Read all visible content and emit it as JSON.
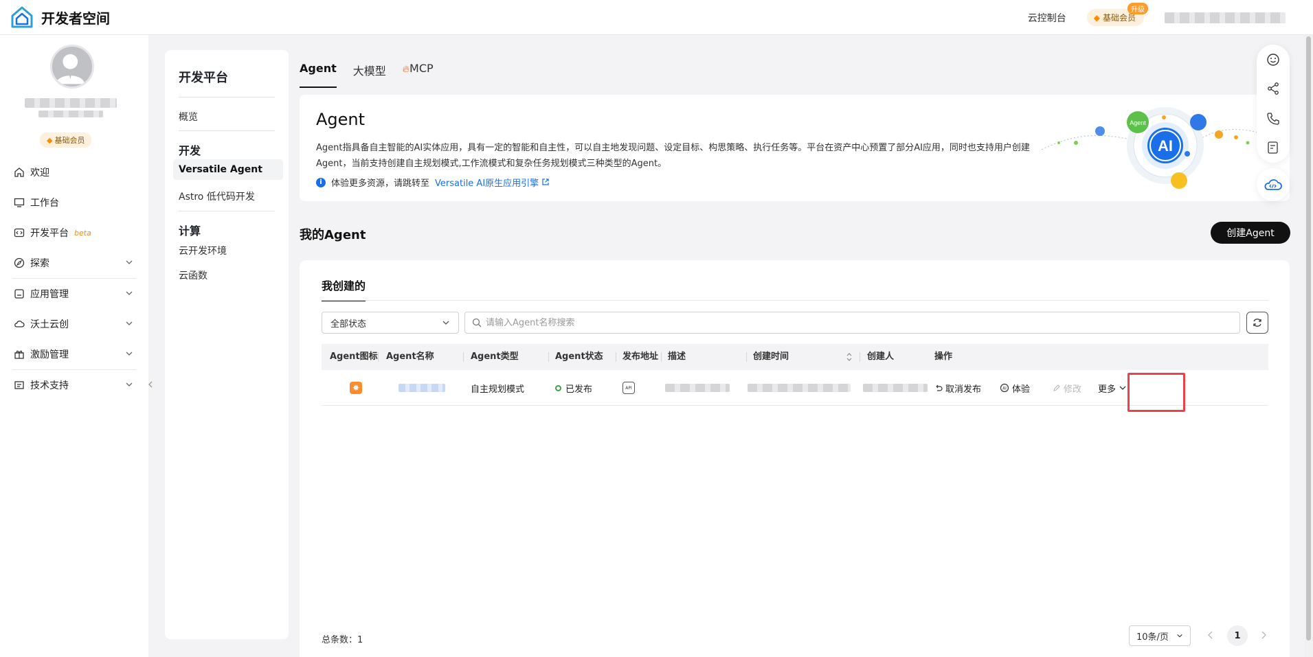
{
  "app": {
    "title": "开发者空间"
  },
  "topbar": {
    "console_label": "云控制台",
    "member_label": "基础会员",
    "upgrade_label": "升级"
  },
  "profile": {
    "badge": "基础会员"
  },
  "sidebar": {
    "items": [
      {
        "label": "欢迎",
        "icon": "home-icon"
      },
      {
        "label": "工作台",
        "icon": "monitor-icon"
      },
      {
        "label": "开发平台",
        "icon": "code-icon",
        "tag": "beta"
      },
      {
        "label": "探索",
        "icon": "compass-icon"
      },
      {
        "label": "应用管理",
        "icon": "app-icon"
      },
      {
        "label": "沃土云创",
        "icon": "cloud-icon"
      },
      {
        "label": "激励管理",
        "icon": "gift-icon"
      },
      {
        "label": "技术支持",
        "icon": "support-icon"
      }
    ]
  },
  "subnav": {
    "title": "开发平台",
    "overview": "概览",
    "group_dev": "开发",
    "versatile": "Versatile Agent",
    "astro": "Astro 低代码开发",
    "group_compute": "计算",
    "cloud_env": "云开发环境",
    "cloud_func": "云函数"
  },
  "tabs": [
    {
      "label": "Agent"
    },
    {
      "label": "大模型"
    },
    {
      "label": "MCP"
    }
  ],
  "intro": {
    "title": "Agent",
    "desc": "Agent指具备自主智能的AI实体应用，具有一定的智能和自主性，可以自主地发现问题、设定目标、构思策略、执行任务等。平台在资产中心预置了部分AI应用，同时也支持用户创建Agent，当前支持创建自主规划模式,工作流模式和复杂任务规划模式三种类型的Agent。",
    "link_prefix": "体验更多资源，请跳转至",
    "link_text": "Versatile AI原生应用引擎",
    "illus_agent": "Agent",
    "illus_ai": "AI"
  },
  "my_agent": {
    "title": "我的Agent",
    "create_button": "创建Agent",
    "tab": "我创建的",
    "status_filter": "全部状态",
    "search_placeholder": "请输入Agent名称搜索",
    "columns": [
      "Agent图标",
      "Agent名称",
      "Agent类型",
      "Agent状态",
      "发布地址",
      "描述",
      "创建时间",
      "创建人",
      "操作"
    ],
    "rows": [
      {
        "type": "自主规划模式",
        "status": "已发布",
        "api": "API"
      }
    ],
    "actions": {
      "unpublish": "取消发布",
      "try": "体验",
      "edit": "修改",
      "more": "更多"
    },
    "total_label": "总条数：",
    "total": "1",
    "page_size": "10条/页",
    "page": "1"
  },
  "colors": {
    "accent": "#1a6fe8",
    "primary_button": "#111111",
    "highlight": "#e8424a",
    "status_ok": "#3ca04a",
    "agent_icon": "#ff8b2c"
  }
}
